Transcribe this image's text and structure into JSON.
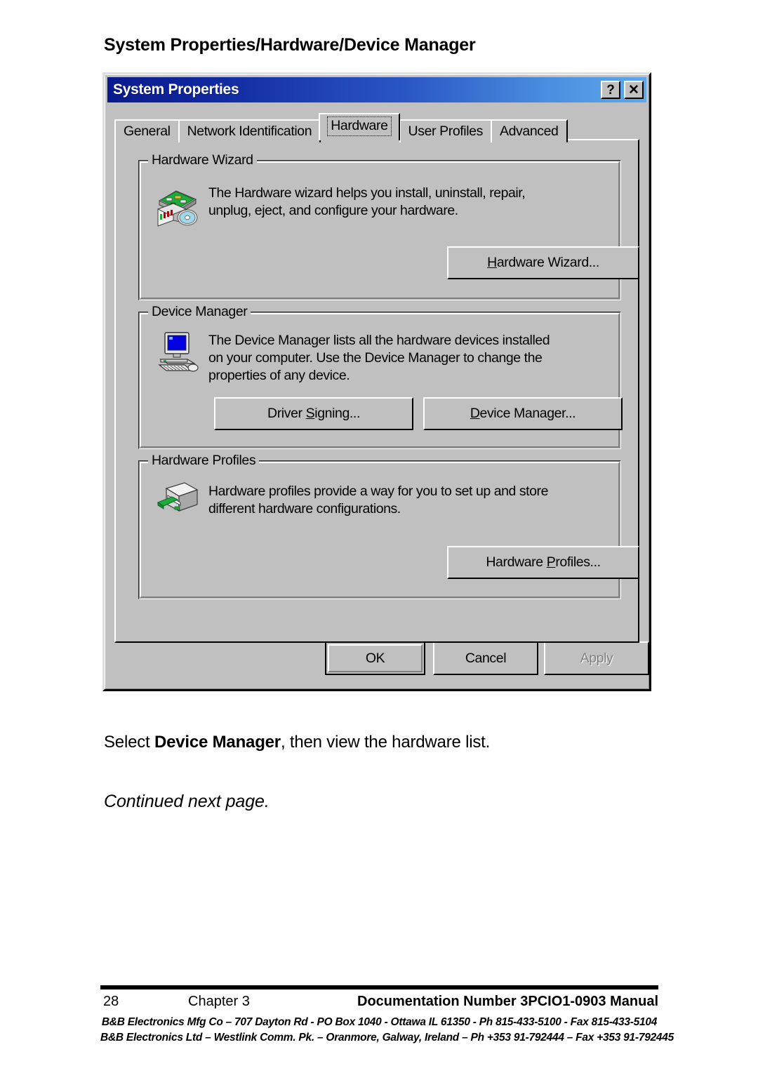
{
  "page": {
    "heading": "System Properties/Hardware/Device Manager",
    "instruction_prefix": "Select ",
    "instruction_bold": "Device Manager",
    "instruction_suffix": ", then view the hardware list.",
    "continued_note": "Continued next page."
  },
  "dialog": {
    "title": "System Properties",
    "titlebar_buttons": [
      {
        "name": "help-button",
        "glyph": "?"
      },
      {
        "name": "close-button",
        "glyph": "✕"
      }
    ],
    "tabs": [
      {
        "label": "General",
        "active": false
      },
      {
        "label": "Network Identification",
        "active": false
      },
      {
        "label": "Hardware",
        "active": true
      },
      {
        "label": "User Profiles",
        "active": false
      },
      {
        "label": "Advanced",
        "active": false
      }
    ],
    "groups": [
      {
        "id": "hardware-wizard",
        "title": "Hardware Wizard",
        "icon": "hardware-wizard-icon",
        "description_lines": [
          "The Hardware wizard helps you install, uninstall, repair,",
          "unplug, eject, and configure your hardware."
        ],
        "buttons": [
          {
            "id": "hardware-wizard-button",
            "accel": "H",
            "rest": "ardware Wizard...",
            "disabled": false
          }
        ]
      },
      {
        "id": "device-manager",
        "title": "Device Manager",
        "icon": "device-manager-icon",
        "description_lines": [
          "The Device Manager lists all the hardware devices installed",
          "on your computer. Use the Device Manager to change the",
          "properties of any device."
        ],
        "buttons": [
          {
            "id": "driver-signing-button",
            "pre": "Driver ",
            "accel": "S",
            "rest": "igning...",
            "disabled": false
          },
          {
            "id": "device-manager-button",
            "accel": "D",
            "rest": "evice Manager...",
            "disabled": false
          }
        ]
      },
      {
        "id": "hardware-profiles",
        "title": "Hardware Profiles",
        "icon": "hardware-profiles-icon",
        "description_lines": [
          "Hardware profiles provide a way for you to set up and store",
          "different hardware configurations."
        ],
        "buttons": [
          {
            "id": "hardware-profiles-button",
            "pre": "Hardware ",
            "accel": "P",
            "rest": "rofiles...",
            "disabled": false
          }
        ]
      }
    ],
    "actions": [
      {
        "id": "ok-button",
        "label": "OK",
        "default": true,
        "disabled": false
      },
      {
        "id": "cancel-button",
        "label": "Cancel",
        "default": false,
        "disabled": false
      },
      {
        "id": "apply-button",
        "label": "Apply",
        "default": false,
        "disabled": true
      }
    ]
  },
  "footer": {
    "page_number": "28",
    "chapter": "Chapter 3",
    "document": "Documentation Number 3PCIO1-0903 Manual",
    "address_us": "B&B Electronics Mfg Co – 707 Dayton Rd - PO Box 1040 - Ottawa IL 61350 - Ph 815-433-5100 - Fax 815-433-5104",
    "address_ie": "B&B Electronics Ltd – Westlink Comm. Pk. – Oranmore, Galway, Ireland – Ph +353 91-792444 – Fax +353 91-792445"
  },
  "colors": {
    "dialog_face": "#c0c0c0",
    "titlebar_start": "#0a1a8c",
    "titlebar_end": "#5fa8ea",
    "screen_blue": "#0000ff",
    "circuit_green": "#00a000"
  }
}
